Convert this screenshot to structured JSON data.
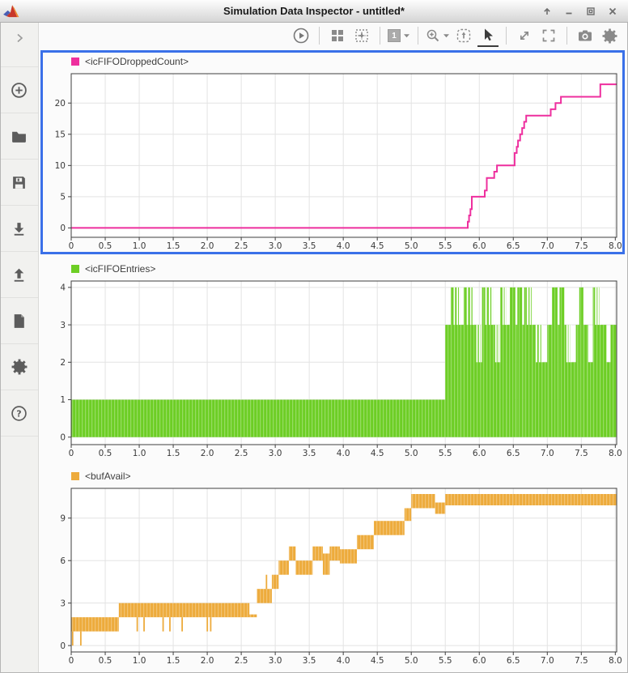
{
  "window": {
    "title": "Simulation Data Inspector - untitled*",
    "buttons": [
      "shade",
      "minimize",
      "maximize",
      "close"
    ]
  },
  "toolbar": {
    "views_label": "1",
    "icons": [
      "run",
      "layout-grid",
      "subplot-layout",
      "view-count",
      "zoom",
      "fit-to-view",
      "pointer",
      "expand-diagonal",
      "fullscreen",
      "snapshot",
      "settings"
    ]
  },
  "sidebar": {
    "icons": [
      "add",
      "open",
      "save",
      "import",
      "export",
      "create-report",
      "preferences",
      "help"
    ]
  },
  "chart_data": [
    {
      "type": "line",
      "subtype": "stairs",
      "legend": "<icFIFODroppedCount>",
      "color": "#ee2f9e",
      "xlim": [
        0,
        8.02
      ],
      "ylim": [
        -1.5,
        24.7
      ],
      "xtick_vals": [
        0,
        0.5,
        1,
        1.5,
        2,
        2.5,
        3,
        3.5,
        4,
        4.5,
        5,
        5.5,
        6,
        6.5,
        7,
        7.5,
        8
      ],
      "xtick_labels": [
        "0",
        "0.5",
        "1.0",
        "1.5",
        "2.0",
        "2.5",
        "3.0",
        "3.5",
        "4.0",
        "4.5",
        "5.0",
        "5.5",
        "6.0",
        "6.5",
        "7.0",
        "7.5",
        "8.0"
      ],
      "ytick_vals": [
        0,
        5,
        10,
        15,
        20
      ],
      "ytick_labels": [
        "0",
        "5",
        "10",
        "15",
        "20"
      ],
      "points": [
        [
          0,
          0
        ],
        [
          5.82,
          0
        ],
        [
          5.83,
          1
        ],
        [
          5.85,
          2
        ],
        [
          5.87,
          3
        ],
        [
          5.89,
          5
        ],
        [
          6.07,
          5
        ],
        [
          6.08,
          6
        ],
        [
          6.11,
          8
        ],
        [
          6.2,
          8
        ],
        [
          6.22,
          9
        ],
        [
          6.26,
          10
        ],
        [
          6.5,
          10
        ],
        [
          6.52,
          12
        ],
        [
          6.55,
          13
        ],
        [
          6.57,
          14
        ],
        [
          6.6,
          15
        ],
        [
          6.63,
          16
        ],
        [
          6.66,
          17
        ],
        [
          6.69,
          18
        ],
        [
          7.03,
          18
        ],
        [
          7.05,
          19
        ],
        [
          7.12,
          20
        ],
        [
          7.2,
          21
        ],
        [
          7.75,
          21
        ],
        [
          7.78,
          23
        ],
        [
          8.02,
          23
        ]
      ]
    },
    {
      "type": "area",
      "subtype": "pulse-envelope",
      "legend": "<icFIFOEntries>",
      "color": "#6dce25",
      "xlim": [
        0,
        8.02
      ],
      "ylim": [
        -0.2,
        4.17
      ],
      "xtick_vals": [
        0,
        0.5,
        1,
        1.5,
        2,
        2.5,
        3,
        3.5,
        4,
        4.5,
        5,
        5.5,
        6,
        6.5,
        7,
        7.5,
        8
      ],
      "xtick_labels": [
        "0",
        "0.5",
        "1.0",
        "1.5",
        "2.0",
        "2.5",
        "3.0",
        "3.5",
        "4.0",
        "4.5",
        "5.0",
        "5.5",
        "6.0",
        "6.5",
        "7.0",
        "7.5",
        "8.0"
      ],
      "ytick_vals": [
        0,
        1,
        2,
        3,
        4
      ],
      "ytick_labels": [
        "0",
        "1",
        "2",
        "3",
        "4"
      ],
      "segments": [
        [
          0,
          5.5,
          1
        ],
        [
          5.5,
          5.58,
          3
        ],
        [
          5.58,
          5.72,
          4
        ],
        [
          5.72,
          5.77,
          3
        ],
        [
          5.77,
          5.92,
          4
        ],
        [
          5.92,
          6.04,
          3
        ],
        [
          6.04,
          6.2,
          4
        ],
        [
          6.2,
          6.31,
          3
        ],
        [
          6.31,
          6.41,
          4
        ],
        [
          6.41,
          6.45,
          3
        ],
        [
          6.45,
          6.53,
          4
        ],
        [
          6.53,
          6.56,
          3
        ],
        [
          6.56,
          6.63,
          4
        ],
        [
          6.63,
          6.66,
          3
        ],
        [
          6.66,
          6.79,
          4
        ],
        [
          6.79,
          6.93,
          3
        ],
        [
          6.93,
          7.0,
          2
        ],
        [
          7.0,
          7.07,
          3
        ],
        [
          7.07,
          7.15,
          4
        ],
        [
          7.15,
          7.18,
          3
        ],
        [
          7.18,
          7.25,
          4
        ],
        [
          7.25,
          7.35,
          3
        ],
        [
          7.35,
          7.42,
          2
        ],
        [
          7.42,
          7.47,
          3
        ],
        [
          7.47,
          7.53,
          4
        ],
        [
          7.53,
          7.6,
          3
        ],
        [
          7.6,
          7.67,
          2
        ],
        [
          7.67,
          7.78,
          4
        ],
        [
          7.78,
          7.87,
          3
        ],
        [
          7.87,
          7.93,
          2
        ],
        [
          7.93,
          8.02,
          3
        ]
      ]
    },
    {
      "type": "area",
      "subtype": "band",
      "legend": "<bufAvail>",
      "color": "#edab3c",
      "xlim": [
        0,
        8.02
      ],
      "ylim": [
        -0.45,
        11.1
      ],
      "xtick_vals": [
        0,
        0.5,
        1,
        1.5,
        2,
        2.5,
        3,
        3.5,
        4,
        4.5,
        5,
        5.5,
        6,
        6.5,
        7,
        7.5,
        8
      ],
      "xtick_labels": [
        "0",
        "0.5",
        "1.0",
        "1.5",
        "2.0",
        "2.5",
        "3.0",
        "3.5",
        "4.0",
        "4.5",
        "5.0",
        "5.5",
        "6.0",
        "6.5",
        "7.0",
        "7.5",
        "8.0"
      ],
      "ytick_vals": [
        0,
        3,
        6,
        9
      ],
      "ytick_labels": [
        "0",
        "3",
        "6",
        "9"
      ],
      "bands": [
        [
          0,
          0.7,
          1,
          2
        ],
        [
          0.7,
          2.62,
          2,
          3
        ],
        [
          2.62,
          2.73,
          2,
          2.2
        ],
        [
          2.73,
          2.95,
          3,
          4
        ],
        [
          2.95,
          3.05,
          4,
          5
        ],
        [
          3.05,
          3.2,
          5,
          6
        ],
        [
          3.2,
          3.3,
          6,
          7
        ],
        [
          3.3,
          3.55,
          5,
          6
        ],
        [
          3.55,
          3.7,
          6,
          7
        ],
        [
          3.7,
          3.8,
          5,
          6.5
        ],
        [
          3.8,
          3.95,
          6,
          7
        ],
        [
          3.95,
          4.2,
          5.8,
          6.8
        ],
        [
          4.2,
          4.45,
          6.8,
          7.8
        ],
        [
          4.45,
          4.9,
          7.8,
          8.8
        ],
        [
          4.9,
          5.0,
          8.8,
          9.7
        ],
        [
          5.0,
          5.35,
          9.7,
          10.7
        ],
        [
          5.35,
          5.5,
          9.3,
          10.1
        ],
        [
          5.5,
          8.02,
          9.9,
          10.7
        ]
      ],
      "spikes": [
        [
          0.02,
          0,
          1
        ],
        [
          0.14,
          0,
          1
        ],
        [
          0.97,
          1,
          2
        ],
        [
          1.07,
          1,
          2
        ],
        [
          1.35,
          1,
          2
        ],
        [
          1.45,
          1,
          2
        ],
        [
          1.63,
          1,
          2
        ],
        [
          2.0,
          1,
          2
        ],
        [
          2.05,
          1,
          2
        ],
        [
          2.87,
          4,
          5
        ]
      ]
    }
  ]
}
